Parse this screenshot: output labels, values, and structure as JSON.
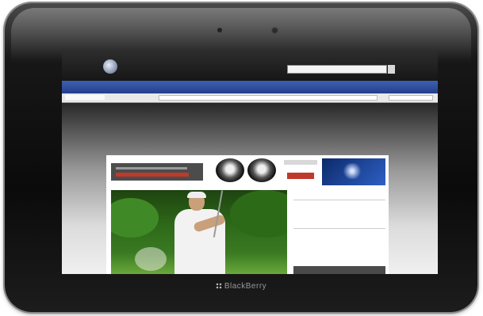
{
  "device": {
    "brand": "BlackBerry"
  },
  "site": {
    "name": "",
    "search_placeholder": "",
    "search_go": "",
    "nav_items": [],
    "sub_left": "",
    "sub_left2": ""
  },
  "sidebar": {
    "title": "",
    "title_link": "",
    "rows": [],
    "bottom_button": ""
  },
  "colors": {
    "nav_blue": "#2f4fa0",
    "ad_red": "#c0392b",
    "bezel": "#111111"
  }
}
